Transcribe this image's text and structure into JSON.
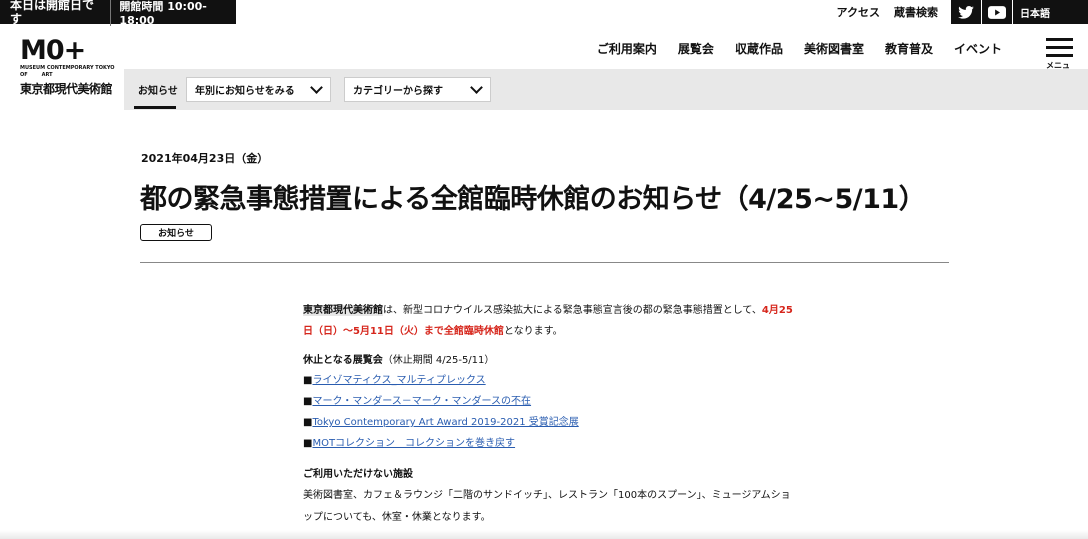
{
  "topbar": {
    "open_status": "本日は開館日です",
    "hours": "開館時間 10:00-18:00",
    "links": [
      "アクセス",
      "蔵書検索"
    ],
    "language": "日本語"
  },
  "logo": {
    "mark": "M0+",
    "sub_line1": "MUSEUM CONTEMPORARY TOKYO",
    "sub_line2": "OF        ART",
    "japanese": "東京都現代美術館"
  },
  "nav": {
    "items": [
      "ご利用案内",
      "展覧会",
      "収蔵作品",
      "美術図書室",
      "教育普及",
      "イベント"
    ],
    "menu_label": "メニュー"
  },
  "subnav": {
    "tab": "お知らせ",
    "year_select": "年別にお知らせをみる",
    "category_select": "カテゴリーから探す"
  },
  "article": {
    "date": "2021年04月23日（金）",
    "title": "都の緊急事態措置による全館臨時休館のお知らせ（4/25~5/11）",
    "tag": "お知らせ",
    "intro_highlight": "東京都現代美術館",
    "intro_text": "は、新型コロナウイルス感染拡大による緊急事態宣言後の都の緊急事態措置として、",
    "intro_red": "4月25日（日）～5月11日（火）まで全館臨時休館",
    "intro_end": "となります。",
    "closed_heading": "休止となる展覧会",
    "closed_note": "（休止期間 4/25-5/11）",
    "bullet": "■",
    "exhibitions": [
      "ライゾマティクス_マルティプレックス",
      "マーク・マンダース－マーク・マンダースの不在",
      "Tokyo Contemporary Art Award 2019-2021 受賞記念展",
      "MOTコレクション　コレクションを巻き戻す"
    ],
    "facilities_heading": "ご利用いただけない施設",
    "facilities_text": "美術図書室、カフェ＆ラウンジ「二階のサンドイッチ」、レストラン「100本のスプーン」、ミュージアムショップについても、休室・休業となります。"
  }
}
